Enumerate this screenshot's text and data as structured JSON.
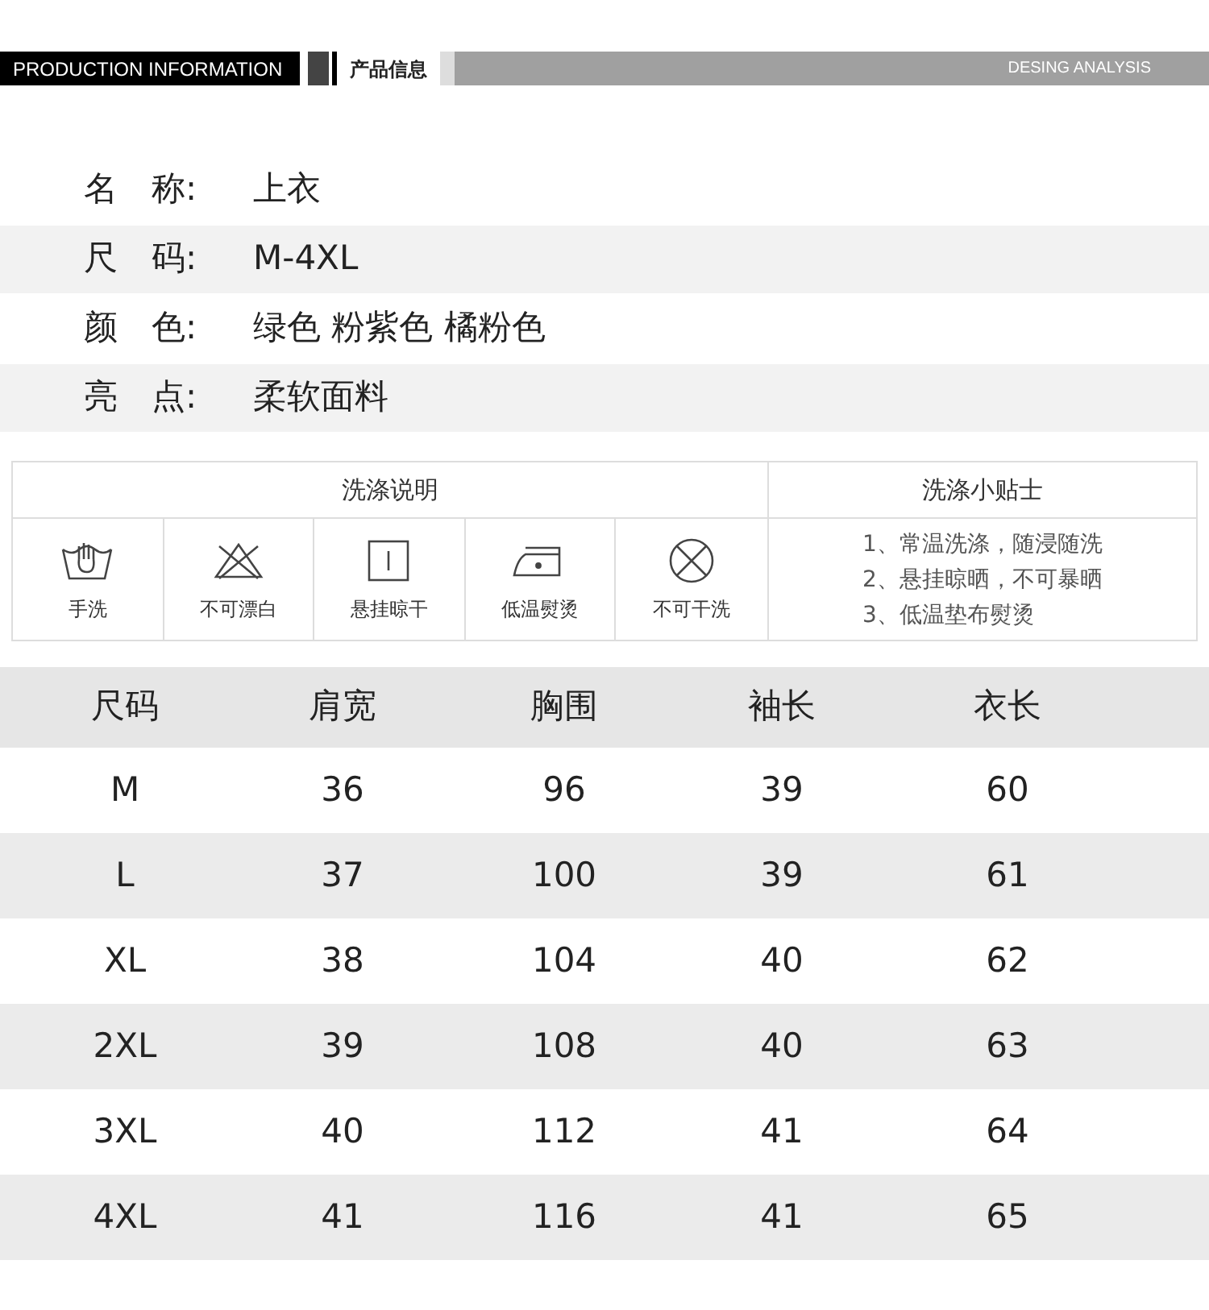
{
  "header": {
    "title_en": "PRODUCTION INFORMATION",
    "title_cn": "产品信息",
    "right": "DESING ANALYSIS"
  },
  "info": [
    {
      "label": "名　称:",
      "value": "上衣"
    },
    {
      "label": "尺　码:",
      "value": "M-4XL"
    },
    {
      "label": "颜　色:",
      "value": "绿色 粉紫色 橘粉色"
    },
    {
      "label": "亮　点:",
      "value": "柔软面料"
    }
  ],
  "care": {
    "title": "洗涤说明",
    "tips_title": "洗涤小贴士",
    "items": [
      {
        "kind": "hand-wash",
        "label": "手洗"
      },
      {
        "kind": "no-bleach",
        "label": "不可漂白"
      },
      {
        "kind": "hang-dry",
        "label": "悬挂晾干"
      },
      {
        "kind": "low-iron",
        "label": "低温熨烫"
      },
      {
        "kind": "no-dry-clean",
        "label": "不可干洗"
      }
    ],
    "tips": [
      "1、常温洗涤，随浸随洗",
      "2、悬挂晾晒，不可暴晒",
      "3、低温垫布熨烫"
    ]
  },
  "size_table": {
    "columns": [
      "尺码",
      "肩宽",
      "胸围",
      "袖长",
      "衣长"
    ],
    "rows": [
      [
        "M",
        "36",
        "96",
        "39",
        "60"
      ],
      [
        "L",
        "37",
        "100",
        "39",
        "61"
      ],
      [
        "XL",
        "38",
        "104",
        "40",
        "62"
      ],
      [
        "2XL",
        "39",
        "108",
        "40",
        "63"
      ],
      [
        "3XL",
        "40",
        "112",
        "41",
        "64"
      ],
      [
        "4XL",
        "41",
        "116",
        "41",
        "65"
      ]
    ]
  }
}
